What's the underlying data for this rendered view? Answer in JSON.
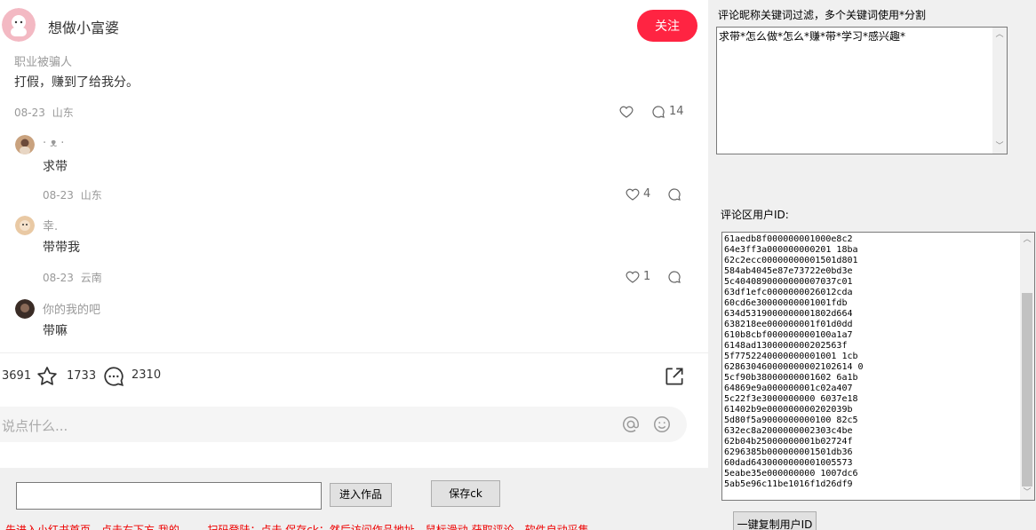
{
  "post": {
    "author_name": "想做小富婆",
    "follow_label": "关注"
  },
  "comment": {
    "username": "职业被骗人",
    "content": "打假，赚到了给我分。",
    "date": "08-23",
    "location": "山东",
    "reply_count": "14"
  },
  "replies": [
    {
      "name": "· ᴥ ·",
      "content": "求带",
      "date": "08-23",
      "location": "山东",
      "likes": "4"
    },
    {
      "name": "幸.",
      "content": "带带我",
      "date": "08-23",
      "location": "云南",
      "likes": "1"
    },
    {
      "name": "你的我的吧",
      "content": "带嘛",
      "date": "",
      "location": "",
      "likes": ""
    }
  ],
  "bottom_bar": {
    "likes": "3691",
    "collects": "1733",
    "comments": "2310",
    "input_placeholder": "说点什么..."
  },
  "controls": {
    "url_value": "",
    "enter_label": "进入作品",
    "save_label": "保存ck",
    "hint": "先进入小红书首页，点击右下方 我的 —— 扫码登陆；点击 保存ck；然后访问作品地址，鼠标滑动 获取评论，软件自动采集"
  },
  "filter": {
    "label": "评论昵称关键词过滤，多个关键词使用*分割",
    "value": "求带*怎么做*怎么*赚*带*学习*感兴趣*"
  },
  "ids": {
    "label": "评论区用户ID:",
    "list": [
      "61aedb8f000000001000e8c2",
      "64e3ff3a000000000201 18ba",
      "62c2ecc00000000001501d801",
      "584ab4045e87e73722e0bd3e",
      "5c4040890000000007037c01",
      "63df1efc0000000026012cda",
      "60cd6e30000000001001fdb",
      "634d5319000000001802d664",
      "638218ee000000001f01d0dd",
      "610b8cbf000000000100a1a7",
      "6148ad1300000000202563f",
      "5f7752240000000001001 1cb",
      "628630460000000002102614 0",
      "5cf90b38000000001602 6a1b",
      "64869e9a000000001c02a407",
      "5c22f3e3000000000 6037e18",
      "61402b9e000000000202039b",
      "5d80f5a9000000000100 82c5",
      "632ec8a2000000002303c4be",
      "62b04b25000000001b02724f",
      "6296385b000000001501db36",
      "60dad6430000000001005573",
      "5eabe35e000000000 1007dc6",
      "5ab5e96c11be1016f1d26df9"
    ],
    "copy_label": "一键复制用户ID"
  },
  "colors": {
    "accent": "#ff2442",
    "hint": "#ee0000"
  }
}
